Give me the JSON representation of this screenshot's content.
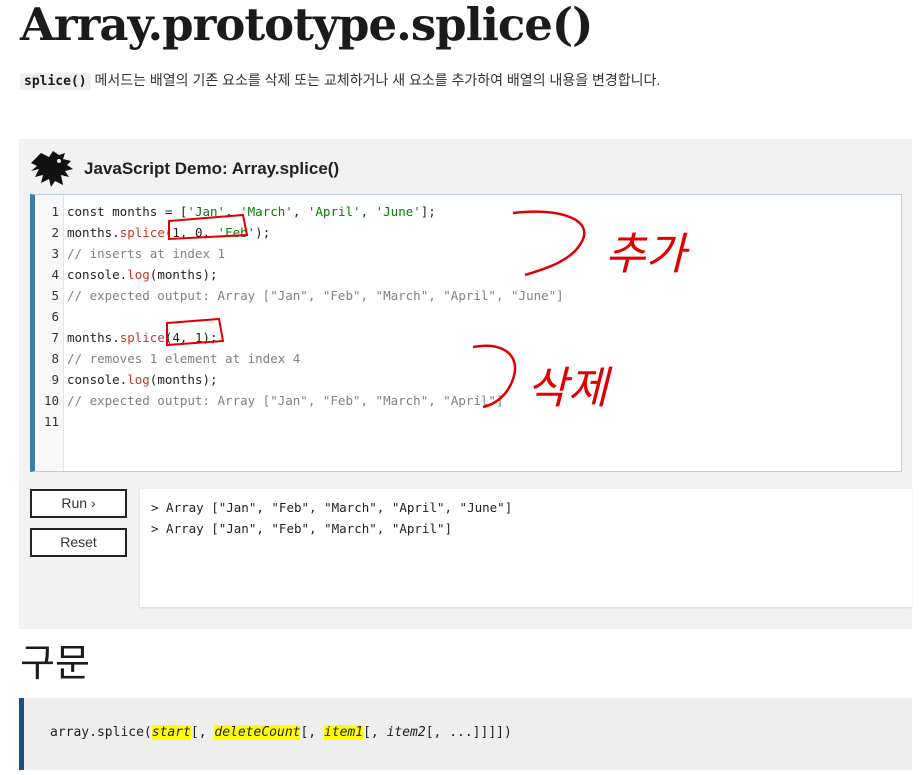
{
  "page": {
    "title": "Array.prototype.splice()",
    "intro_code": "splice()",
    "intro_text": " 메서드는 배열의 기존 요소를 삭제 또는 교체하거나 새 요소를 추가하여 배열의 내용을 변경합니다."
  },
  "demo": {
    "title": "JavaScript Demo: Array.splice()",
    "code_lines": [
      {
        "n": "1",
        "parts": [
          [
            "plain",
            "const months = ["
          ],
          [
            "str",
            "'Jan'"
          ],
          [
            "plain",
            ", "
          ],
          [
            "str",
            "'March'"
          ],
          [
            "plain",
            ", "
          ],
          [
            "str",
            "'April'"
          ],
          [
            "plain",
            ", "
          ],
          [
            "str",
            "'June'"
          ],
          [
            "plain",
            "];"
          ]
        ]
      },
      {
        "n": "2",
        "parts": [
          [
            "plain",
            "months."
          ],
          [
            "fn",
            "splice"
          ],
          [
            "plain",
            "(1, 0, "
          ],
          [
            "str",
            "'Feb'"
          ],
          [
            "plain",
            ");"
          ]
        ]
      },
      {
        "n": "3",
        "parts": [
          [
            "cmt",
            "// inserts at index 1"
          ]
        ]
      },
      {
        "n": "4",
        "parts": [
          [
            "plain",
            "console."
          ],
          [
            "fn",
            "log"
          ],
          [
            "plain",
            "(months);"
          ]
        ]
      },
      {
        "n": "5",
        "parts": [
          [
            "cmt",
            "// expected output: Array [\"Jan\", \"Feb\", \"March\", \"April\", \"June\"]"
          ]
        ]
      },
      {
        "n": "6",
        "parts": []
      },
      {
        "n": "7",
        "parts": [
          [
            "plain",
            "months."
          ],
          [
            "fn",
            "splice"
          ],
          [
            "plain",
            "(4, 1);"
          ]
        ]
      },
      {
        "n": "8",
        "parts": [
          [
            "cmt",
            "// removes 1 element at index 4"
          ]
        ]
      },
      {
        "n": "9",
        "parts": [
          [
            "plain",
            "console."
          ],
          [
            "fn",
            "log"
          ],
          [
            "plain",
            "(months);"
          ]
        ]
      },
      {
        "n": "10",
        "parts": [
          [
            "cmt",
            "// expected output: Array [\"Jan\", \"Feb\", \"March\", \"April\"]"
          ]
        ]
      },
      {
        "n": "11",
        "parts": []
      }
    ],
    "run_label": "Run ›",
    "reset_label": "Reset",
    "console_output": [
      "> Array [\"Jan\", \"Feb\", \"March\", \"April\", \"June\"]",
      "> Array [\"Jan\", \"Feb\", \"March\", \"April\"]"
    ]
  },
  "annotations": {
    "add_note": "추가",
    "delete_note": "삭제",
    "ink_color": "#e00000"
  },
  "syntax": {
    "heading": "구문",
    "prefix": "array.splice(",
    "start": "start",
    "sep1": "[, ",
    "deleteCount": "deleteCount",
    "sep2": "[, ",
    "item1": "item1",
    "sep3": "[, ",
    "item2": "item2",
    "suffix": "[, ...]]]])"
  },
  "colors": {
    "string": "#0a7a0a",
    "comment": "#808080",
    "function": "#c0392b",
    "editor_accent": "#3b7ea1",
    "highlight": "#ffff00"
  }
}
